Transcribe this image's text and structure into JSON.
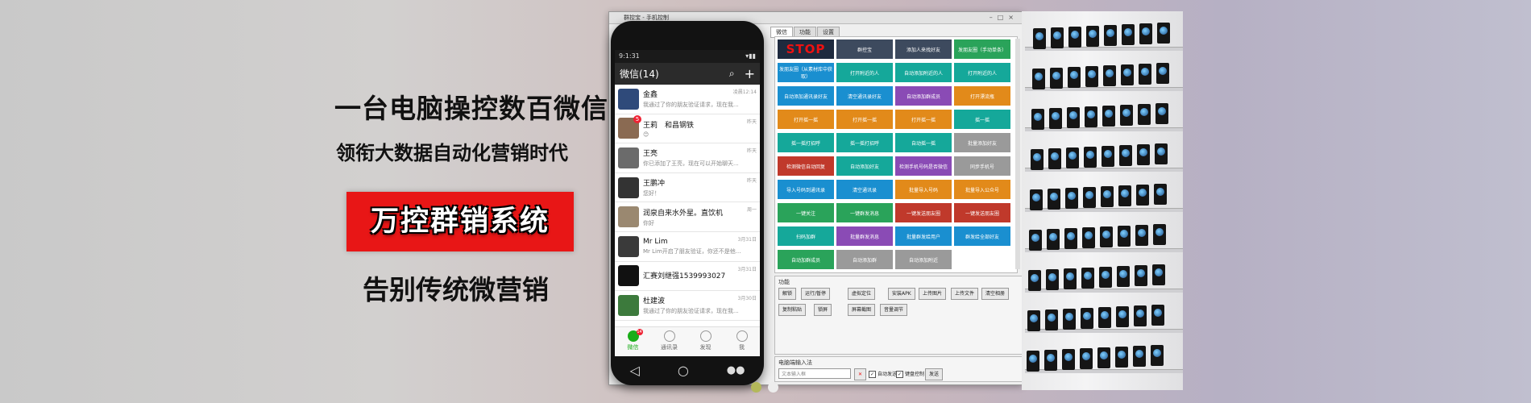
{
  "promo": {
    "headline": "一台电脑操控数百微信",
    "subheadline": "领衔大数据自动化营销时代",
    "brand": "万控群销系统",
    "tagline": "告别传统微营销"
  },
  "phone": {
    "status_time": "9:1:31",
    "title": "微信(14)",
    "chats": [
      {
        "name": "金鑫",
        "msg": "我通过了你的朋友验证请求，现在我...",
        "time": "凌晨12:14",
        "color": "#2f4a7a",
        "badge": ""
      },
      {
        "name": "王莉　和昌钢铁",
        "msg": "😊",
        "time": "昨天",
        "color": "#8a6a52",
        "badge": "5"
      },
      {
        "name": "王亮",
        "msg": "你已添加了王亮，现在可以开始聊天...",
        "time": "昨天",
        "color": "#6b6b6b",
        "badge": ""
      },
      {
        "name": "王鹏冲",
        "msg": "您好！",
        "time": "昨天",
        "color": "#333333",
        "badge": ""
      },
      {
        "name": "润泉自来水外星。直饮机",
        "msg": "你好",
        "time": "周一",
        "color": "#9a8870",
        "badge": ""
      },
      {
        "name": "Mr Lim",
        "msg": "Mr Lim开启了朋友验证，你还不是他...",
        "time": "3月31日",
        "color": "#3a3a3a",
        "badge": ""
      },
      {
        "name": "汇赛刘继强15399930​27",
        "msg": "",
        "time": "3月31日",
        "color": "#111111",
        "badge": ""
      },
      {
        "name": "杜建波",
        "msg": "我通过了你的朋友验证请求，现在我...",
        "time": "3月30日",
        "color": "#3c7a3c",
        "badge": ""
      }
    ],
    "tabs": [
      {
        "label": "微信",
        "badge": "14"
      },
      {
        "label": "通讯录",
        "badge": ""
      },
      {
        "label": "发现",
        "badge": ""
      },
      {
        "label": "我",
        "badge": ""
      }
    ]
  },
  "software": {
    "title": "群控宝 - 手机控制",
    "tabs": [
      "微信",
      "功能",
      "设置"
    ],
    "tiles": [
      {
        "label": "STOP",
        "color": "#1e2a3e"
      },
      {
        "label": "群控宝",
        "color": "#3d4a5e"
      },
      {
        "label": "添加人来找好友",
        "color": "#3d4a5e"
      },
      {
        "label": "发朋友圈（手动单条）",
        "color": "#2aa35a"
      },
      {
        "label": "发朋友圈（从素材库中获取）",
        "color": "#1a8fd0"
      },
      {
        "label": "打开附近的人",
        "color": "#15a89a"
      },
      {
        "label": "自动添加附近的人",
        "color": "#15a89a"
      },
      {
        "label": "打开附近的人",
        "color": "#15a89a"
      },
      {
        "label": "自动添加通讯录好友",
        "color": "#1a8fd0"
      },
      {
        "label": "清空通讯录好友",
        "color": "#1a8fd0"
      },
      {
        "label": "自动添加群成员",
        "color": "#8a4bb5"
      },
      {
        "label": "打开漂流瓶",
        "color": "#e28a1a"
      },
      {
        "label": "打开摇一摇",
        "color": "#e28a1a"
      },
      {
        "label": "打开摇一摇",
        "color": "#e28a1a"
      },
      {
        "label": "打开摇一摇",
        "color": "#e28a1a"
      },
      {
        "label": "摇一摇",
        "color": "#15a89a"
      },
      {
        "label": "摇一摇打招呼",
        "color": "#15a89a"
      },
      {
        "label": "摇一摇打招呼",
        "color": "#15a89a"
      },
      {
        "label": "自动摇一摇",
        "color": "#15a89a"
      },
      {
        "label": "批量添加好友",
        "color": "#9a9a9a"
      },
      {
        "label": "检测微信自动回复",
        "color": "#c0392b"
      },
      {
        "label": "自动添加好友",
        "color": "#15a89a"
      },
      {
        "label": "检测手机号码是否微信",
        "color": "#8a4bb5"
      },
      {
        "label": "同步手机号",
        "color": "#9a9a9a"
      },
      {
        "label": "导入号码到通讯录",
        "color": "#1a8fd0"
      },
      {
        "label": "清空通讯录",
        "color": "#1a8fd0"
      },
      {
        "label": "批量导入号码",
        "color": "#e28a1a"
      },
      {
        "label": "批量导入公众号",
        "color": "#e28a1a"
      },
      {
        "label": "一键关注",
        "color": "#2aa35a"
      },
      {
        "label": "一键群发消息",
        "color": "#2aa35a"
      },
      {
        "label": "一键发送朋友圈",
        "color": "#c0392b"
      },
      {
        "label": "一键发送朋友圈",
        "color": "#c0392b"
      },
      {
        "label": "扫码加群",
        "color": "#15a89a"
      },
      {
        "label": "批量群发消息",
        "color": "#8a4bb5"
      },
      {
        "label": "批量群发给用户",
        "color": "#1a8fd0"
      },
      {
        "label": "群发给全部好友",
        "color": "#1a8fd0"
      },
      {
        "label": "自动加群成员",
        "color": "#2aa35a"
      },
      {
        "label": "自动添加群",
        "color": "#9a9a9a"
      },
      {
        "label": "自动添加附近",
        "color": "#9a9a9a"
      }
    ],
    "function_label": "功能",
    "function_buttons": [
      "解锁",
      "运行/暂停",
      "虚拟定位",
      "安装APK",
      "上传图片",
      "上传文件",
      "清空相册",
      "复制粘贴",
      "锁屏",
      "屏幕截图",
      "音量调节"
    ],
    "input_label": "电脑端输入法",
    "input_placeholder": "文本输入框",
    "options": [
      "自动发送",
      "键盘控制"
    ],
    "send_button": "发送"
  },
  "carousel": {
    "dots": [
      "#b3b85a",
      "#ededed"
    ]
  }
}
